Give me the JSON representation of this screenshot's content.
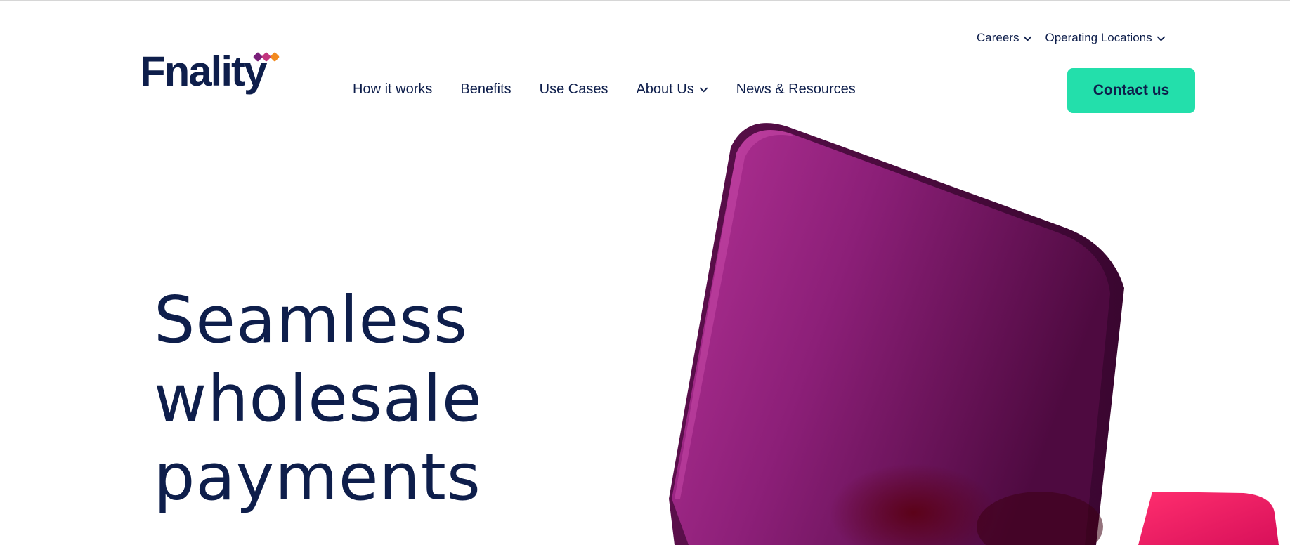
{
  "brand": {
    "name": "Fnality",
    "colors": {
      "navy": "#0e1e4b",
      "accent_green": "#23dfab",
      "magenta": "#9b2a8a",
      "orange": "#f28a1f"
    }
  },
  "utility_nav": {
    "items": [
      {
        "label": "Careers",
        "icon": "chevron-down-icon"
      },
      {
        "label": "Operating Locations",
        "icon": "chevron-down-icon"
      }
    ]
  },
  "main_nav": {
    "items": [
      {
        "label": "How it works"
      },
      {
        "label": "Benefits"
      },
      {
        "label": "Use Cases"
      },
      {
        "label": "About Us",
        "icon": "chevron-down-icon"
      },
      {
        "label": "News & Resources"
      }
    ]
  },
  "cta": {
    "label": "Contact us"
  },
  "hero": {
    "title_lines": [
      "Seamless",
      "wholesale",
      "payments"
    ]
  }
}
